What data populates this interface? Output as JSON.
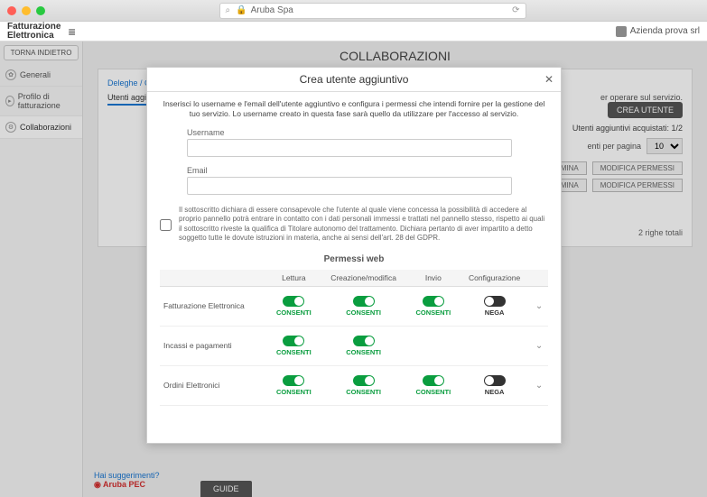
{
  "titlebar": {
    "site": "Aruba Spa"
  },
  "header": {
    "brand_line1": "Fatturazione",
    "brand_line2": "Elettronica",
    "user": "Azienda prova srl"
  },
  "sidebar": {
    "back": "TORNA INDIETRO",
    "items": [
      {
        "label": "Generali"
      },
      {
        "label": "Profilo di fatturazione"
      },
      {
        "label": "Collaborazioni"
      }
    ]
  },
  "page": {
    "title": "COLLABORAZIONI",
    "breadcrumb": "Deleghe / Co",
    "tab": "Utenti aggiun",
    "desc_suffix": "er operare sul servizio.",
    "create_btn": "CREA UTENTE",
    "quota": "Utenti aggiuntivi acquistati: 1/2",
    "perpage_label": "enti per pagina",
    "perpage_value": "10",
    "row_btn_delete": "IMINA",
    "row_btn_edit": "MODIFICA PERMESSI",
    "total": "2 righe totali"
  },
  "footer": {
    "suggest": "Hai suggerimenti?",
    "pec": "Aruba PEC",
    "guide": "GUIDE"
  },
  "modal": {
    "title": "Crea utente aggiuntivo",
    "intro": "Inserisci lo username e l'email dell'utente aggiuntivo e configura i permessi che intendi fornire per la gestione del tuo servizio. Lo username creato in questa fase sarà quello da utilizzare per l'accesso al servizio.",
    "username_label": "Username",
    "email_label": "Email",
    "disclaimer": "Il sottoscritto dichiara di essere consapevole che l'utente al quale viene concessa la possibilità di accedere al proprio pannello potrà entrare in contatto con i dati personali immessi e trattati nel pannello stesso, rispetto ai quali il sottoscritto riveste la qualifica di Titolare autonomo del trattamento. Dichiara pertanto di aver impartito a detto soggetto tutte le dovute istruzioni in materia, anche ai sensi dell'art. 28 del GDPR.",
    "perms_title": "Permessi web",
    "col_read": "Lettura",
    "col_create": "Creazione/modifica",
    "col_send": "Invio",
    "col_config": "Configurazione",
    "consent": "CONSENTI",
    "deny": "NEGA",
    "rows": [
      {
        "label": "Fatturazione Elettronica",
        "cols": [
          "on",
          "on",
          "on",
          "off"
        ]
      },
      {
        "label": "Incassi e pagamenti",
        "cols": [
          "on",
          "on",
          null,
          null
        ]
      },
      {
        "label": "Ordini Elettronici",
        "cols": [
          "on",
          "on",
          "on",
          "off"
        ]
      }
    ]
  }
}
